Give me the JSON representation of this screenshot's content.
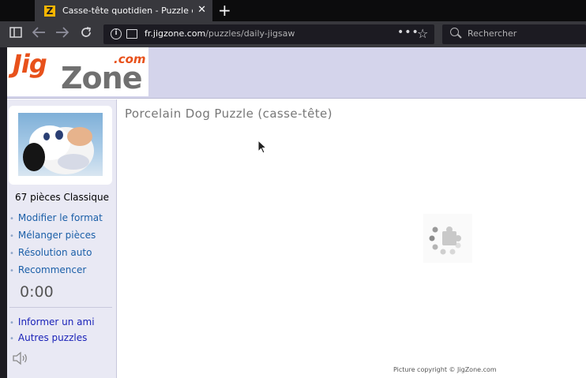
{
  "browser": {
    "tab_title": "Casse-tête quotidien - Puzzle du",
    "tab_favicon_letter": "Z",
    "new_tab_label": "+",
    "url_domain": "fr.jigzone.com",
    "url_path": "/puzzles/daily-jigsaw",
    "search_placeholder": "Rechercher",
    "icons": [
      "sidebar-icon",
      "back-icon",
      "forward-icon",
      "reload-icon",
      "info-icon",
      "image-icon",
      "more-icon",
      "bookmark-star-icon",
      "search-icon",
      "close-icon"
    ]
  },
  "site": {
    "logo_jig": "Jig",
    "logo_zone": "Zone",
    "logo_com": ".com",
    "accent_color": "#e8511b",
    "header_color": "#d4d4eb"
  },
  "sidebar": {
    "pieces_label": "67 pièces Classique",
    "links_top": [
      {
        "label": "Modifier le format"
      },
      {
        "label": "Mélanger pièces"
      },
      {
        "label": "Résolution auto"
      },
      {
        "label": "Recommencer"
      }
    ],
    "timer": "0:00",
    "links_bottom": [
      {
        "label": "Informer un ami"
      },
      {
        "label": "Autres puzzles"
      }
    ],
    "icons": [
      "puzzle-thumbnail",
      "speaker-icon"
    ]
  },
  "main": {
    "title": "Porcelain Dog Puzzle (casse-tête)",
    "copyright": "Picture copyright © JigZone.com",
    "loading_icon": "loading-spinner-icon"
  }
}
